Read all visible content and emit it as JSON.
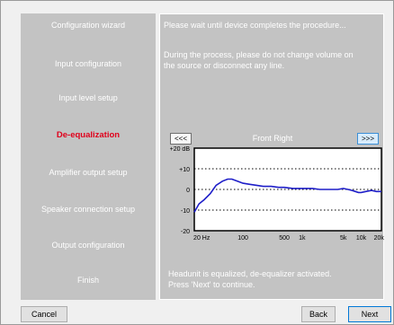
{
  "sidebar": {
    "items": [
      {
        "label": "Configuration wizard",
        "active": false
      },
      {
        "label": "Input configuration",
        "active": false
      },
      {
        "label": "Input level setup",
        "active": false
      },
      {
        "label": "De-equalization",
        "active": true
      },
      {
        "label": "Amplifier output setup",
        "active": false
      },
      {
        "label": "Speaker connection setup",
        "active": false
      },
      {
        "label": "Output configuration",
        "active": false
      },
      {
        "label": "Finish",
        "active": false
      }
    ]
  },
  "main": {
    "wait_text": "Please wait until device completes the procedure...",
    "warning_line1": "During the process, please do not change volume on",
    "warning_line2": "the source or disconnect any line.",
    "prev_label": "<<<",
    "next_label": ">>>",
    "channel": "Front Right",
    "status_line1": "Headunit is equalized, de-equalizer activated.",
    "status_line2": "Press 'Next' to continue."
  },
  "buttons": {
    "cancel": "Cancel",
    "back": "Back",
    "next": "Next"
  },
  "colors": {
    "panel": "#c3c3c3",
    "active_step": "#e0001b",
    "curve": "#1e1ec8"
  },
  "chart_data": {
    "type": "line",
    "x_scale": "log",
    "xlim": [
      15,
      22000
    ],
    "ylim": [
      -20,
      20
    ],
    "x_ticks": [
      {
        "v": 20,
        "label": "20 Hz"
      },
      {
        "v": 100,
        "label": "100"
      },
      {
        "v": 500,
        "label": "500"
      },
      {
        "v": 1000,
        "label": "1k"
      },
      {
        "v": 5000,
        "label": "5k"
      },
      {
        "v": 10000,
        "label": "10k"
      },
      {
        "v": 20000,
        "label": "20k"
      }
    ],
    "y_ticks": [
      {
        "v": 20,
        "label": "+20 dB"
      },
      {
        "v": 10,
        "label": "+10"
      },
      {
        "v": 0,
        "label": "0"
      },
      {
        "v": -10,
        "label": "-10"
      },
      {
        "v": -20,
        "label": "-20"
      }
    ],
    "gridlines_y": [
      10,
      0,
      -10
    ],
    "series": [
      {
        "x": [
          15,
          18,
          22,
          28,
          35,
          45,
          55,
          65,
          80,
          100,
          130,
          170,
          220,
          300,
          400,
          500,
          700,
          1000,
          1500,
          2000,
          3000,
          4000,
          5000,
          6000,
          7000,
          8000,
          9000,
          10000,
          12000,
          15000,
          18000,
          22000
        ],
        "y": [
          -11,
          -7,
          -5,
          -2,
          2,
          4,
          5,
          5,
          4,
          3,
          2.5,
          2,
          1.5,
          1.5,
          1,
          1,
          0.5,
          0.5,
          0.5,
          0,
          0,
          0,
          0.5,
          0,
          -0.5,
          -1,
          -1.5,
          -1.5,
          -1,
          -0.5,
          -1,
          -1
        ]
      }
    ]
  }
}
